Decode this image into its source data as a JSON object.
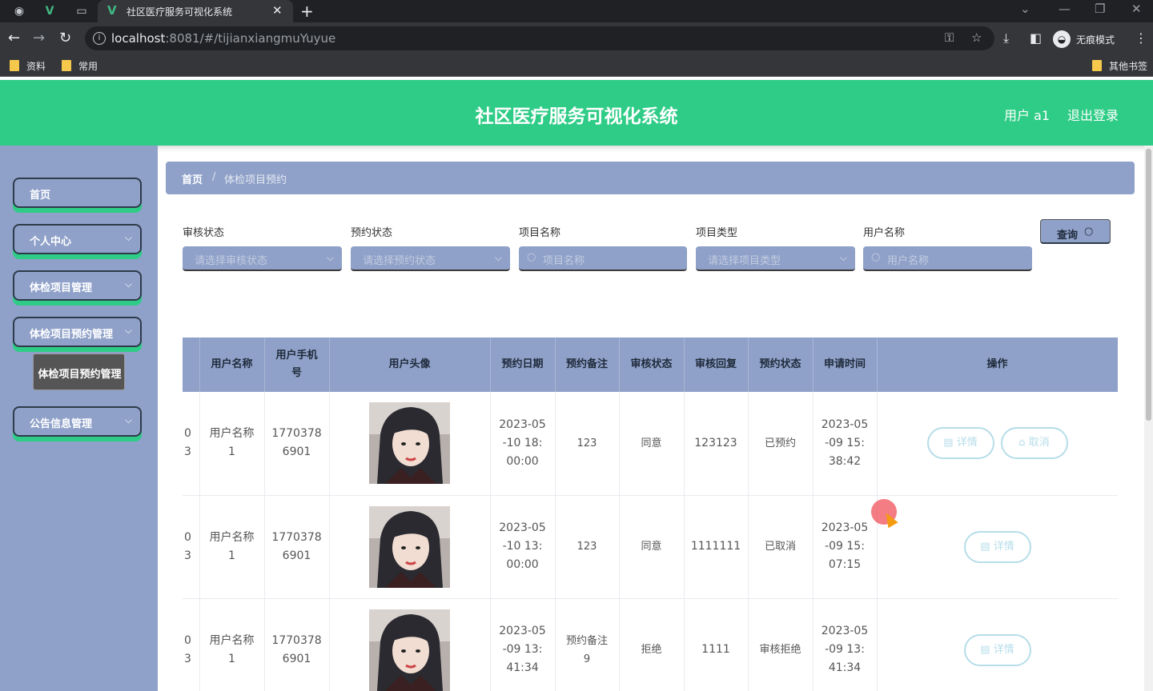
{
  "browser": {
    "tab_title": "社区医疗服务可视化系统",
    "url_host": "localhost",
    "url_rest": ":8081/#/tijianxiangmuYuyue",
    "incognito_label": "无痕模式",
    "bookmarks": [
      "资料",
      "常用"
    ],
    "other_bookmarks": "其他书签"
  },
  "header": {
    "title": "社区医疗服务可视化系统",
    "user": "用户 a1",
    "logout": "退出登录",
    "color": "#2ecc86"
  },
  "sidebar": {
    "items": [
      {
        "label": "首页"
      },
      {
        "label": "个人中心"
      },
      {
        "label": "体检项目管理"
      },
      {
        "label": "体检项目预约管理"
      },
      {
        "label": "公告信息管理"
      }
    ],
    "active_sub": "体检项目预约管理",
    "color": "#8fa1c9"
  },
  "breadcrumb": {
    "home": "首页",
    "sep": "/",
    "current": "体检项目预约"
  },
  "filters": {
    "audit_status": {
      "label": "审核状态",
      "placeholder": "请选择审核状态"
    },
    "booking_status": {
      "label": "预约状态",
      "placeholder": "请选择预约状态"
    },
    "project_name": {
      "label": "项目名称",
      "placeholder": "项目名称"
    },
    "project_type": {
      "label": "项目类型",
      "placeholder": "请选择项目类型"
    },
    "user_name": {
      "label": "用户名称",
      "placeholder": "用户名称"
    },
    "query": "查询"
  },
  "table": {
    "columns": [
      "用户名称",
      "用户手机号",
      "用户头像",
      "预约日期",
      "预约备注",
      "审核状态",
      "审核回复",
      "预约状态",
      "申请时间",
      "操作"
    ],
    "rows": [
      {
        "cut": "0\n3",
        "user": "用户名称1",
        "phone": "17703786901",
        "date": "2023-05-10 18:00:00",
        "note": "123",
        "audit": "同意",
        "reply": "123123",
        "status": "已预约",
        "applied": "2023-05-09 15:38:42",
        "actions": [
          "详情",
          "取消"
        ]
      },
      {
        "cut": "0\n3",
        "user": "用户名称1",
        "phone": "17703786901",
        "date": "2023-05-10 13:00:00",
        "note": "123",
        "audit": "同意",
        "reply": "1111111",
        "status": "已取消",
        "applied": "2023-05-09 15:07:15",
        "actions": [
          "详情"
        ]
      },
      {
        "cut": "0\n3",
        "user": "用户名称1",
        "phone": "17703786901",
        "date": "2023-05-09 13:41:34",
        "note": "预约备注9",
        "audit": "拒绝",
        "reply": "1111",
        "status": "审核拒绝",
        "applied": "2023-05-09 13:41:34",
        "actions": [
          "详情"
        ]
      }
    ]
  }
}
